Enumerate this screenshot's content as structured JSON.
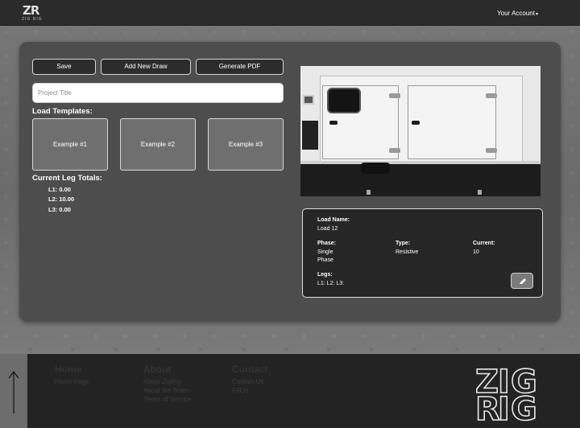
{
  "header": {
    "logo_mark": "ZR",
    "logo_sub": "ZIG RIG",
    "account_label": "Your Account"
  },
  "toolbar": {
    "save_label": "Save",
    "add_draw_label": "Add New Draw",
    "pdf_label": "Generate PDF"
  },
  "project": {
    "placeholder": "Project Title"
  },
  "templates": {
    "heading": "Load Templates:",
    "items": [
      "Example #1",
      "Example #2",
      "Example #3"
    ]
  },
  "legs": {
    "heading": "Current Leg Totals:",
    "lines": [
      "L1: 0.00",
      "L2: 10.00",
      "L3: 0.00"
    ]
  },
  "load": {
    "name_label": "Load Name:",
    "name_value": "Load 12",
    "phase_label": "Phase:",
    "phase_value_1": "Single",
    "phase_value_2": "Phase",
    "type_label": "Type:",
    "type_value": "Resistive",
    "current_label": "Current:",
    "current_value": "10",
    "legs_label": "Legs:",
    "legs_value": "L1: L2: L3:"
  },
  "footer": {
    "home_heading": "Home",
    "home_links": [
      "Home Page"
    ],
    "about_heading": "About",
    "about_links": [
      "About ZigRig",
      "About the Team",
      "Terms of Service"
    ],
    "contact_heading": "Contact",
    "contact_links": [
      "Contact Us",
      "FAQs"
    ],
    "big_logo": [
      "Z",
      "I",
      "G",
      "R",
      "I",
      "G"
    ]
  },
  "icons": {
    "account_caret": "caret-down-icon",
    "edit": "pencil-icon",
    "back_to_top": "arrow-up-icon"
  }
}
